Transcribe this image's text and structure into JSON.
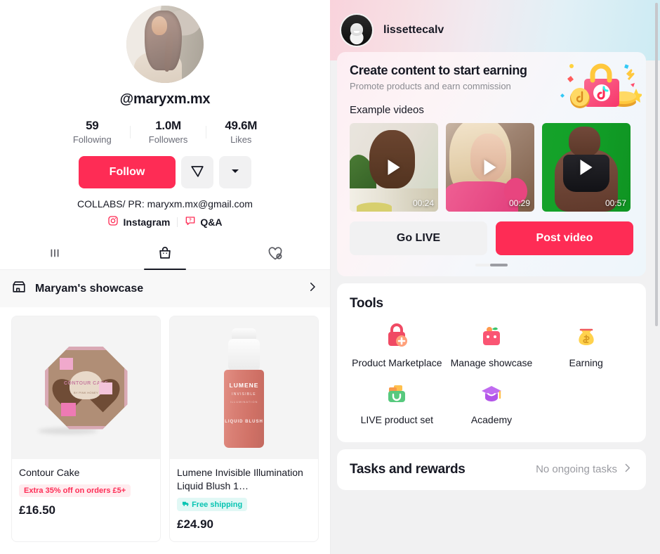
{
  "profile": {
    "avatar_alt": "profile-avatar",
    "handle": "@maryxm.mx",
    "stats": [
      {
        "num": "59",
        "label": "Following"
      },
      {
        "num": "1.0M",
        "label": "Followers"
      },
      {
        "num": "49.6M",
        "label": "Likes"
      }
    ],
    "follow_label": "Follow",
    "message_icon": "send-message-icon",
    "more_icon": "chevron-down-icon",
    "bio": "COLLABS/ PR: maryxm.mx@gmail.com",
    "links": [
      {
        "label": "Instagram",
        "icon": "instagram-icon"
      },
      {
        "label": "Q&A",
        "icon": "question-bubble-icon"
      }
    ],
    "tabs": [
      {
        "name": "videos",
        "icon": "grid-posts-icon",
        "active": false
      },
      {
        "name": "shop",
        "icon": "shopping-bag-icon",
        "active": true
      },
      {
        "name": "liked",
        "icon": "heart-hidden-icon",
        "active": false
      }
    ]
  },
  "showcase": {
    "icon": "storefront-icon",
    "title": "Maryam's showcase",
    "chevron": "chevron-right-icon",
    "products": [
      {
        "name": "Contour Cake",
        "badge": "Extra 35% off on orders £5+",
        "badge_type": "discount",
        "price": "£16.50",
        "art": "contour-cake",
        "art_label": "CONTOUR CAKE",
        "art_sublabel": "BY PINK HONEY"
      },
      {
        "name": "Lumene Invisible Illumination Liquid Blush 1…",
        "badge": "Free shipping",
        "badge_type": "shipping",
        "badge_icon": "truck-icon",
        "price": "£24.90",
        "art": "lumene-bottle",
        "art_brand": "LUMENE",
        "art_line1": "INVISIBLE",
        "art_line2": "ILLUMINATION",
        "art_line3": "LIQUID BLUSH"
      }
    ]
  },
  "creator_panel": {
    "account_name": "lissettecalv",
    "account_avatar": "account-avatar",
    "earning_card": {
      "title": "Create content to start earning",
      "subtitle": "Promote products and earn commission",
      "illustration": "shopping-bag-coins-icon",
      "examples_label": "Example videos",
      "videos": [
        {
          "duration": "00:24",
          "play_icon": "play-icon",
          "scene": "v1"
        },
        {
          "duration": "00:29",
          "play_icon": "play-icon",
          "scene": "v2"
        },
        {
          "duration": "00:57",
          "play_icon": "play-icon",
          "scene": "v3"
        },
        {
          "duration": "",
          "play_icon": "play-icon",
          "scene": "v4"
        }
      ],
      "go_live_label": "Go LIVE",
      "post_video_label": "Post video"
    },
    "tools": {
      "title": "Tools",
      "items": [
        {
          "label": "Product Marketplace",
          "icon": "product-marketplace-icon"
        },
        {
          "label": "Manage showcase",
          "icon": "manage-showcase-icon"
        },
        {
          "label": "Earning",
          "icon": "money-bag-icon"
        },
        {
          "label": "LIVE product set",
          "icon": "live-product-set-icon"
        },
        {
          "label": "Academy",
          "icon": "graduation-cap-icon"
        }
      ]
    },
    "tasks": {
      "title": "Tasks and rewards",
      "status": "No ongoing tasks",
      "chevron": "chevron-right-icon"
    }
  },
  "colors": {
    "accent_red": "#FE2C55",
    "text_primary": "#161823",
    "text_secondary": "#6b6d78",
    "badge_discount_bg": "#FFECEF",
    "badge_shipping_bg": "#E1F8F5",
    "badge_shipping_text": "#08C4B2",
    "panel_grey": "#F1F1F2"
  }
}
